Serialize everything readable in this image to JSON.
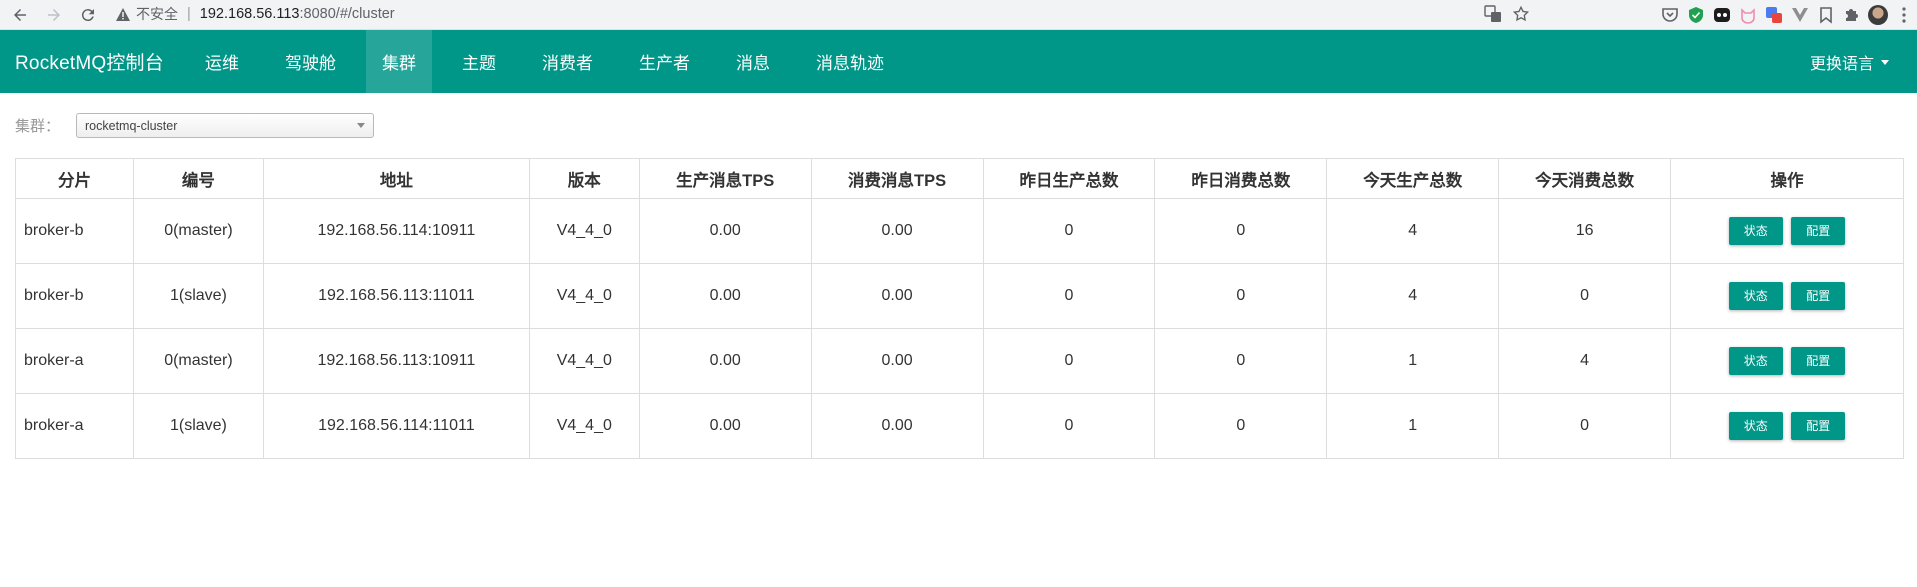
{
  "browser": {
    "not_secure": "不安全",
    "url_host": "192.168.56.113",
    "url_path": ":8080/#/cluster"
  },
  "app": {
    "brand": "RocketMQ控制台",
    "nav": [
      "运维",
      "驾驶舱",
      "集群",
      "主题",
      "消费者",
      "生产者",
      "消息",
      "消息轨迹"
    ],
    "active_nav": "集群",
    "language": "更换语言",
    "accent_color": "#009688"
  },
  "cluster_select": {
    "label": "集群：",
    "value": "rocketmq-cluster"
  },
  "table": {
    "headers": [
      "分片",
      "编号",
      "地址",
      "版本",
      "生产消息TPS",
      "消费消息TPS",
      "昨日生产总数",
      "昨日消费总数",
      "今天生产总数",
      "今天消费总数",
      "操作"
    ],
    "rows": [
      [
        "broker-b",
        "0(master)",
        "192.168.56.114:10911",
        "V4_4_0",
        "0.00",
        "0.00",
        "0",
        "0",
        "4",
        "16"
      ],
      [
        "broker-b",
        "1(slave)",
        "192.168.56.113:11011",
        "V4_4_0",
        "0.00",
        "0.00",
        "0",
        "0",
        "4",
        "0"
      ],
      [
        "broker-a",
        "0(master)",
        "192.168.56.113:10911",
        "V4_4_0",
        "0.00",
        "0.00",
        "0",
        "0",
        "1",
        "4"
      ],
      [
        "broker-a",
        "1(slave)",
        "192.168.56.114:11011",
        "V4_4_0",
        "0.00",
        "0.00",
        "0",
        "0",
        "1",
        "0"
      ]
    ],
    "status_label": "状态",
    "config_label": "配置"
  }
}
